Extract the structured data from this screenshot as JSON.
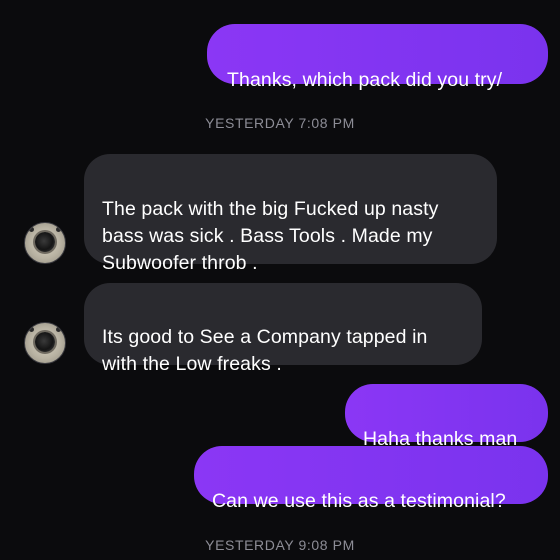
{
  "messages": [
    {
      "direction": "outgoing",
      "text": "Thanks, which pack did you try/"
    },
    {
      "type": "timestamp",
      "text": "YESTERDAY 7:08 PM"
    },
    {
      "direction": "incoming",
      "text": "The pack with the big Fucked up nasty\nbass was sick . Bass Tools . Made my\nSubwoofer throb .",
      "avatar": "speaker-avatar"
    },
    {
      "direction": "incoming",
      "text": "Its good to See a Company tapped in\nwith the Low freaks .",
      "avatar": "speaker-avatar"
    },
    {
      "direction": "outgoing",
      "text": "Haha thanks man"
    },
    {
      "direction": "outgoing",
      "text": "Can we use this as a testimonial?"
    },
    {
      "type": "timestamp",
      "text": "YESTERDAY 9:08 PM"
    }
  ],
  "colors": {
    "background": "#0b0b0d",
    "outgoing_bubble": "#7b33ee",
    "incoming_bubble": "#2a2a2f",
    "timestamp_text": "#8d8d96",
    "message_text": "#ffffff"
  }
}
